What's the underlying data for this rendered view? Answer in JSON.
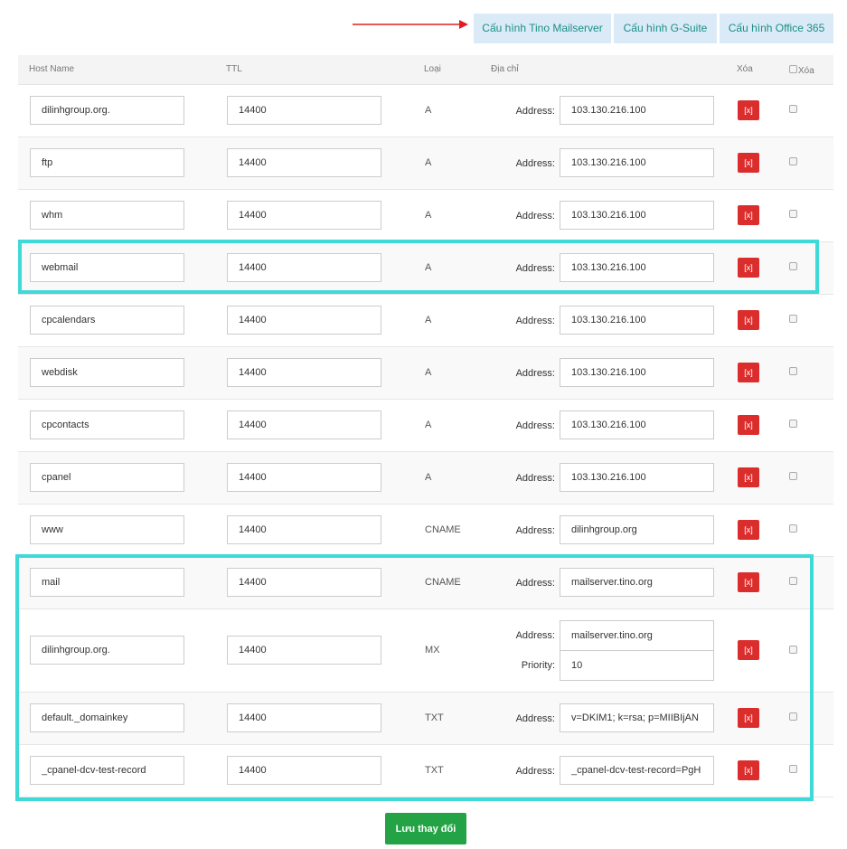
{
  "toolbar": {
    "tino_label": "Cấu hình Tino Mailserver",
    "gsuite_label": "Cấu hình G-Suite",
    "office_label": "Cấu hình Office 365"
  },
  "colors": {
    "accent": "#1c8f87",
    "highlight": "#3fd9d8",
    "delete": "#dc2d2d",
    "save": "#23a346",
    "arrow": "#e02020"
  },
  "table": {
    "headers": {
      "host": "Host Name",
      "ttl": "TTL",
      "type": "Loại",
      "address": "Địa chỉ",
      "delete": "Xóa",
      "delete_check": "Xóa"
    },
    "rows": [
      {
        "host": "dilinhgroup.org.",
        "ttl": "14400",
        "type": "A",
        "address_label": "Address:",
        "address": "103.130.216.100",
        "delete": "[x]"
      },
      {
        "host": "ftp",
        "ttl": "14400",
        "type": "A",
        "address_label": "Address:",
        "address": "103.130.216.100",
        "delete": "[x]"
      },
      {
        "host": "whm",
        "ttl": "14400",
        "type": "A",
        "address_label": "Address:",
        "address": "103.130.216.100",
        "delete": "[x]"
      },
      {
        "host": "webmail",
        "ttl": "14400",
        "type": "A",
        "address_label": "Address:",
        "address": "103.130.216.100",
        "delete": "[x]"
      },
      {
        "host": "cpcalendars",
        "ttl": "14400",
        "type": "A",
        "address_label": "Address:",
        "address": "103.130.216.100",
        "delete": "[x]"
      },
      {
        "host": "webdisk",
        "ttl": "14400",
        "type": "A",
        "address_label": "Address:",
        "address": "103.130.216.100",
        "delete": "[x]"
      },
      {
        "host": "cpcontacts",
        "ttl": "14400",
        "type": "A",
        "address_label": "Address:",
        "address": "103.130.216.100",
        "delete": "[x]"
      },
      {
        "host": "cpanel",
        "ttl": "14400",
        "type": "A",
        "address_label": "Address:",
        "address": "103.130.216.100",
        "delete": "[x]"
      },
      {
        "host": "www",
        "ttl": "14400",
        "type": "CNAME",
        "address_label": "Address:",
        "address": "dilinhgroup.org",
        "delete": "[x]"
      },
      {
        "host": "mail",
        "ttl": "14400",
        "type": "CNAME",
        "address_label": "Address:",
        "address": "mailserver.tino.org",
        "delete": "[x]"
      },
      {
        "host": "dilinhgroup.org.",
        "ttl": "14400",
        "type": "MX",
        "address_label": "Address:",
        "address": "mailserver.tino.org",
        "priority_label": "Priority:",
        "priority": "10",
        "delete": "[x]"
      },
      {
        "host": "default._domainkey",
        "ttl": "14400",
        "type": "TXT",
        "address_label": "Address:",
        "address": "v=DKIM1; k=rsa; p=MIIBIjAN",
        "delete": "[x]"
      },
      {
        "host": "_cpanel-dcv-test-record",
        "ttl": "14400",
        "type": "TXT",
        "address_label": "Address:",
        "address": "_cpanel-dcv-test-record=PgH",
        "delete": "[x]"
      }
    ]
  },
  "footer": {
    "save_label": "Lưu thay đổi"
  }
}
